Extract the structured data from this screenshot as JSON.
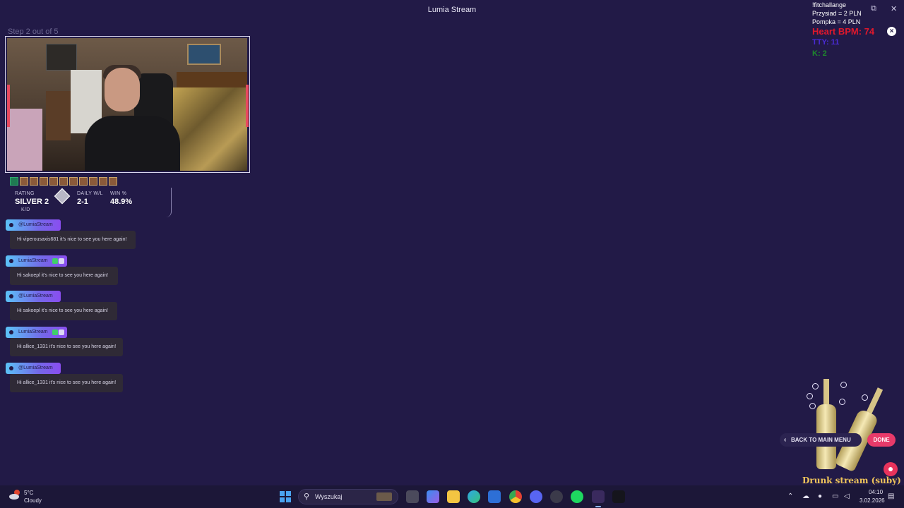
{
  "window": {
    "title": "Lumia Stream",
    "minimize_glyph": "⧉",
    "close_glyph": "✕"
  },
  "wizard": {
    "step_label": "Step 2 out of 5",
    "back_label": "BACK TO MAIN MENU",
    "done_label": "DONE"
  },
  "stats": {
    "rating_label": "RATING",
    "rating_value": "SILVER 2",
    "daily_label": "DAILY W/L",
    "daily_value": "2-1",
    "win_label": "WIN %",
    "win_value": "48.9%",
    "kd_label": "K/D"
  },
  "chat": [
    {
      "name": "@LumiaStream",
      "message": "Hi viperousaxis681 it's nice to see you here again!"
    },
    {
      "name": "LumiaStream",
      "message": "Hi sakoepl it's nice to see you here again!"
    },
    {
      "name": "@LumiaStream",
      "message": "Hi sakoepl it's nice to see you here again!"
    },
    {
      "name": "LumiaStream",
      "message": "Hi allice_1331 it's nice to see you here again!"
    },
    {
      "name": "@LumiaStream",
      "message": "Hi allice_1331 it's nice to see you here again!"
    }
  ],
  "overlay": {
    "challenge_title": "!fitchallange",
    "line1": "Przysiad = 2 PLN",
    "line2": "Pompka = 4 PLN",
    "bpm": "Heart BPM: 74",
    "tty": "TTY: 11",
    "kills": "K: 2",
    "drunk_title": "Drunk stream (suby)"
  },
  "taskbar": {
    "weather_temp": "5°C",
    "weather_desc": "Cloudy",
    "search_placeholder": "Wyszukaj",
    "time": "04:10",
    "date": "3.02.2026"
  },
  "colors": {
    "background": "#221a47",
    "done_button": "#e83a6a",
    "bpm_text": "#e0182c",
    "tty_text": "#4a2bd6",
    "kills_text": "#1e8a2c"
  },
  "icons": [
    "search-icon",
    "windows-start-icon",
    "chevron-left-icon",
    "close-icon",
    "weather-icon",
    "chat-bubble-icon"
  ]
}
